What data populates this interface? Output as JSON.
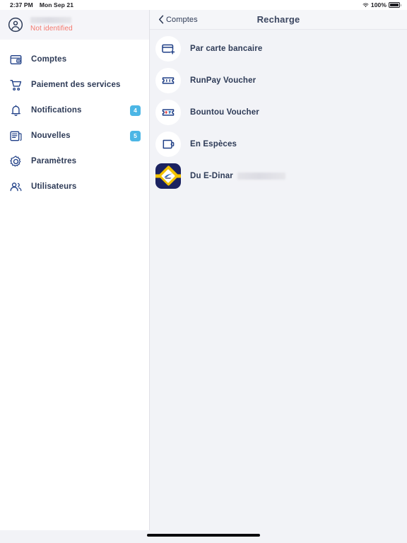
{
  "status_bar": {
    "time": "2:37 PM",
    "date": "Mon Sep 21",
    "wifi_icon": "wifi-icon",
    "battery_percent": "100%",
    "battery_icon": "battery-full-icon"
  },
  "sidebar": {
    "profile": {
      "avatar_icon": "user-circle-icon",
      "name_redacted": "",
      "status": "Not identified",
      "status_color": "#f4776c"
    },
    "items": [
      {
        "label": "Comptes",
        "icon": "wallet-icon",
        "badge": ""
      },
      {
        "label": "Paiement des services",
        "icon": "shopping-cart-icon",
        "badge": ""
      },
      {
        "label": "Notifications",
        "icon": "bell-icon",
        "badge": "4"
      },
      {
        "label": "Nouvelles",
        "icon": "newspaper-icon",
        "badge": "5"
      },
      {
        "label": "Paramètres",
        "icon": "gear-icon",
        "badge": ""
      },
      {
        "label": "Utilisateurs",
        "icon": "users-icon",
        "badge": ""
      }
    ],
    "badge_color": "#4cb6e5"
  },
  "detail": {
    "navbar": {
      "back_label": "Comptes",
      "back_icon": "chevron-left-icon",
      "title": "Recharge"
    },
    "options": [
      {
        "label": "Par carte bancaire",
        "icon": "credit-card-plus-icon",
        "redacted": false
      },
      {
        "label": "RunPay Voucher",
        "icon": "ticket-icon",
        "redacted": false
      },
      {
        "label": "Bountou Voucher",
        "icon": "ticket-colored-icon",
        "redacted": false
      },
      {
        "label": "En Espèces",
        "icon": "cash-wallet-icon",
        "redacted": false
      },
      {
        "label": "Du E-Dinar",
        "icon": "edinar-logo-icon",
        "redacted": true
      }
    ]
  },
  "colors": {
    "accent_navy": "#1f3f86",
    "text_navy": "#2e3b57",
    "sidebar_bg": "#ffffff",
    "detail_bg": "#f2f3f7"
  }
}
